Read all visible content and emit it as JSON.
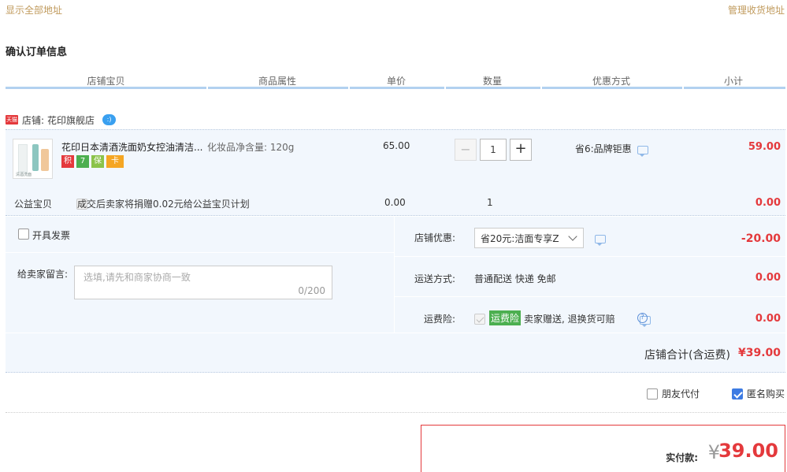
{
  "top_links": {
    "show_all": "显示全部地址",
    "manage": "管理收货地址"
  },
  "section_title": "确认订单信息",
  "columns": [
    "店铺宝贝",
    "商品属性",
    "单价",
    "数量",
    "优惠方式",
    "小计"
  ],
  "shop": {
    "badge": "天猫",
    "label": "店铺:",
    "name": "花印旗舰店"
  },
  "item": {
    "title": "花印日本清酒洗面奶女控油清洁...",
    "attribute": "化妆品净含量: 120g",
    "price": "65.00",
    "quantity": "1",
    "discount": "省6:品牌钜惠",
    "subtotal": "59.00",
    "tags": [
      "积",
      "7",
      "保",
      "卡"
    ],
    "image_text": "清酒洗面"
  },
  "charity": {
    "label": "公益宝贝",
    "text": "成交后卖家将捐赠0.02元给公益宝贝计划",
    "price": "0.00",
    "quantity": "1",
    "subtotal": "0.00"
  },
  "invoice": {
    "label": "开具发票"
  },
  "message": {
    "label": "给卖家留言:",
    "placeholder": "选填,请先和商家协商一致",
    "counter": "0/200"
  },
  "shop_discount": {
    "label": "店铺优惠:",
    "selected": "省20元:洁面专享Z",
    "amount": "-20.00"
  },
  "shipping": {
    "label": "运送方式:",
    "value": "普通配送 快递 免邮",
    "amount": "0.00"
  },
  "insurance": {
    "label": "运费险:",
    "badge": "运费险",
    "text": "卖家赠送, 退换货可赔",
    "amount": "0.00"
  },
  "shop_total": {
    "label": "店铺合计(含运费)",
    "amount": "¥39.00"
  },
  "options": {
    "friend_pay": "朋友代付",
    "anonymous": "匿名购买"
  },
  "payment": {
    "label": "实付款:",
    "currency": "¥",
    "amount": "39.00"
  },
  "colors": {
    "accent_red": "#e4393c",
    "link_gold": "#c09a5c",
    "header_bar": "#b2d1f0",
    "row_bg": "#f2f7fd"
  }
}
